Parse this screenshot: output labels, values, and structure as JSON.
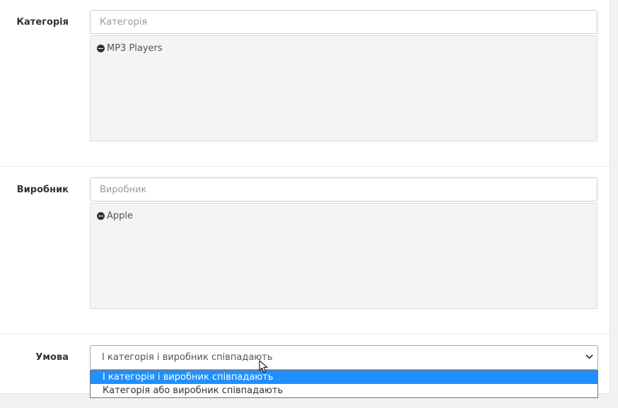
{
  "category": {
    "label": "Категорія",
    "placeholder": "Категорія",
    "items": [
      {
        "label": "MP3 Players",
        "icon": "minus-circle-icon"
      }
    ]
  },
  "manufacturer": {
    "label": "Виробник",
    "placeholder": "Виробник",
    "items": [
      {
        "label": "Apple",
        "icon": "minus-circle-icon"
      }
    ]
  },
  "condition": {
    "label": "Умова",
    "selected": "І категорія і виробник співпадають",
    "options": [
      {
        "label": "І категорія і виробник співпадають",
        "highlighted": true
      },
      {
        "label": "Категорія або виробник співпадають",
        "highlighted": false
      }
    ]
  },
  "colors": {
    "highlight": "#1e90ff",
    "well_background": "#f4f4f4",
    "label_text": "#333333"
  }
}
